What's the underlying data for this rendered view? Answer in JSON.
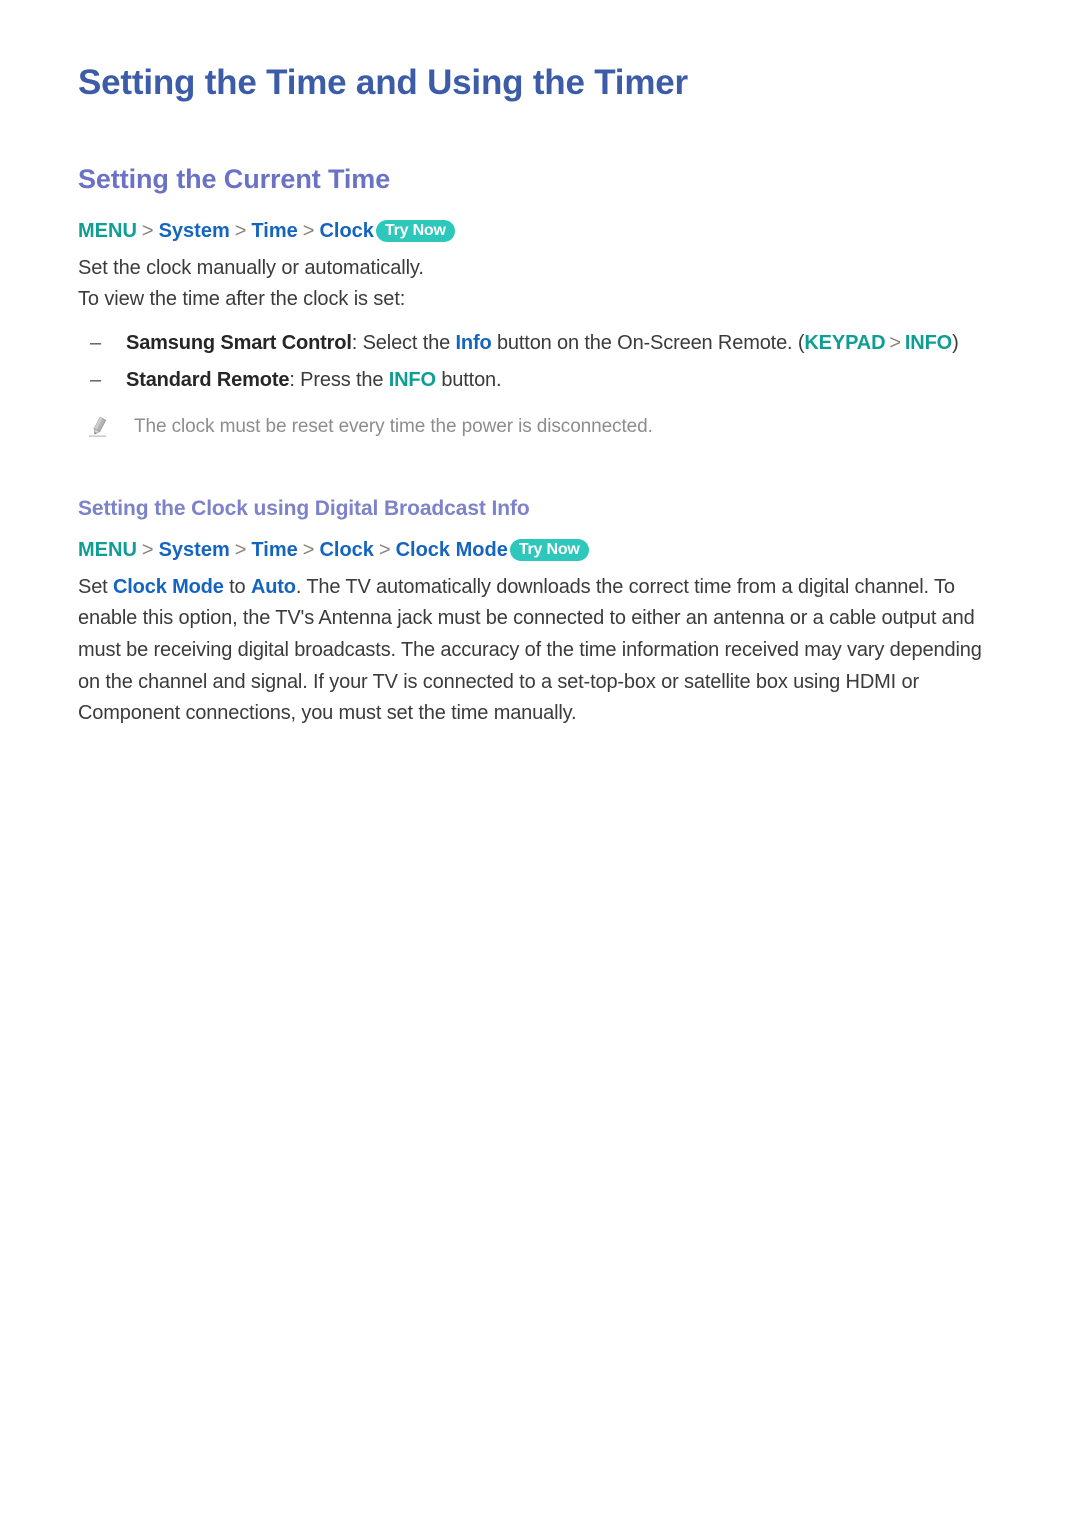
{
  "document": {
    "title": "Setting the Time and Using the Timer"
  },
  "sections": [
    {
      "heading": "Setting the Current Time",
      "menu_path": {
        "root": "MENU",
        "items": [
          "System",
          "Time",
          "Clock"
        ],
        "separator": ">",
        "badge": "Try Now"
      },
      "lines": [
        "Set the clock manually or automatically.",
        "To view the time after the clock is set:"
      ],
      "bullets": [
        {
          "marker": "–",
          "term": "Samsung Smart Control",
          "colon": ":",
          "text_before": " Select the ",
          "highlight": "Info",
          "text_after": " button on the On-Screen Remote. ",
          "paren_open": "(",
          "tail_a": "KEYPAD",
          "tail_sep": ">",
          "tail_b": "INFO",
          "paren_close": ")"
        },
        {
          "marker": "–",
          "term": "Standard Remote",
          "colon": ":",
          "text_before": " Press the ",
          "highlight": "INFO",
          "text_after": " button."
        }
      ],
      "note": {
        "icon": "pencil-icon",
        "text": "The clock must be reset every time the power is disconnected."
      }
    },
    {
      "sub_heading": "Setting the Clock using Digital Broadcast Info",
      "menu_path": {
        "root": "MENU",
        "items": [
          "System",
          "Time",
          "Clock",
          "Clock Mode"
        ],
        "separator": ">",
        "badge": "Try Now"
      },
      "paragraph": {
        "lead": "Set ",
        "term_a": "Clock Mode",
        "mid": " to ",
        "term_b": "Auto",
        "rest": ". The TV automatically downloads the correct time from a digital channel. To enable this option, the TV's Antenna jack must be connected to either an antenna or a cable output and must be receiving digital broadcasts. The accuracy of the time information received may vary depending on the channel and signal. If your TV is connected to a set-top-box or satellite box using HDMI or Component connections, you must set the time manually."
      }
    }
  ],
  "colors": {
    "title": "#3c5ca8",
    "heading": "#6b72c6",
    "sub_heading": "#7d82c9",
    "menu_root": "#0e9e94",
    "menu_item": "#1565c0",
    "badge_bg": "#2ec7bb",
    "badge_text": "#ffffff",
    "body": "#3b3b3b",
    "note": "#8d8d8d",
    "accent_blue": "#1565c0",
    "accent_teal": "#0e9e94",
    "page_background": "#ffffff"
  }
}
